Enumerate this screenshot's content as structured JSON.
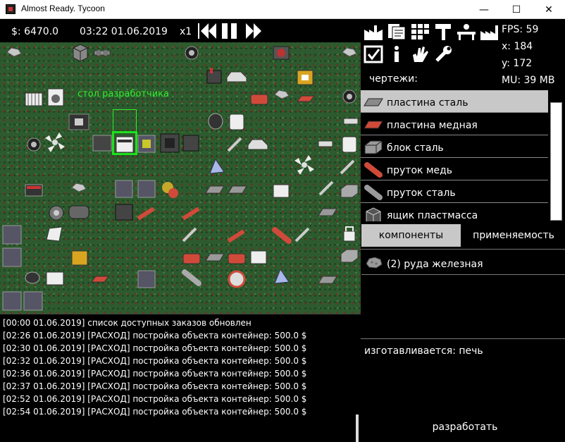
{
  "window": {
    "title": "Almost Ready. Tycoon",
    "minimize": "—",
    "maximize": "☐",
    "close": "✕"
  },
  "hud": {
    "money": "$: 6470.0",
    "datetime": "03:22 01.06.2019",
    "speed": "x1"
  },
  "map": {
    "label": "стол разработчика"
  },
  "stats": {
    "fps": "FPS: 59",
    "x": "x: 184",
    "y": "y: 172",
    "mu": "MU: 39 MB"
  },
  "blueprints": {
    "label": "чертежи:",
    "items": [
      {
        "label": "пластина сталь",
        "icon": "steel-plate-icon",
        "color": "#8a8a8a"
      },
      {
        "label": "пластина медная",
        "icon": "copper-plate-icon",
        "color": "#d04a3a"
      },
      {
        "label": "блок сталь",
        "icon": "steel-block-icon",
        "color": "#8a8a8a"
      },
      {
        "label": "пруток медь",
        "icon": "copper-rod-icon",
        "color": "#d04a3a"
      },
      {
        "label": "пруток сталь",
        "icon": "steel-rod-icon",
        "color": "#9a9a9a"
      },
      {
        "label": "ящик пластмасса",
        "icon": "plastic-box-icon",
        "color": "#444444"
      }
    ]
  },
  "tabs": {
    "components": "компоненты",
    "usage": "применяемость"
  },
  "components": {
    "item": "(2) руда железная"
  },
  "made_in": "изготавливается: печь",
  "develop": "разработать",
  "log": [
    "[00:00 01.06.2019] список доступных заказов обновлен",
    "[02:26 01.06.2019] [РАСХОД] постройка объекта контейнер: 500.0 $",
    "[02:30 01.06.2019] [РАСХОД] постройка объекта контейнер: 500.0 $",
    "[02:32 01.06.2019] [РАСХОД] постройка объекта контейнер: 500.0 $",
    "[02:36 01.06.2019] [РАСХОД] постройка объекта контейнер: 500.0 $",
    "[02:37 01.06.2019] [РАСХОД] постройка объекта контейнер: 500.0 $",
    "[02:52 01.06.2019] [РАСХОД] постройка объекта контейнер: 500.0 $",
    "[02:54 01.06.2019] [РАСХОД] постройка объекта контейнер: 500.0 $"
  ],
  "colors": {
    "map_grass": "#2d5a2e",
    "label_green": "#2ef02e",
    "selected_row": "#c8c8c8"
  }
}
